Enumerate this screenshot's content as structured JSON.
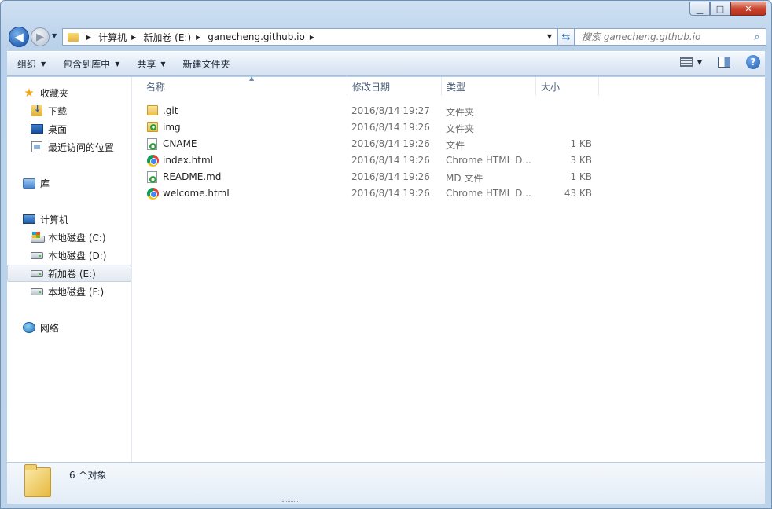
{
  "window": {
    "minimize_glyph": "▁",
    "maximize_glyph": "□",
    "close_glyph": "✕"
  },
  "nav": {
    "back_glyph": "◀",
    "forward_glyph": "▶",
    "breadcrumbs": [
      "计算机",
      "新加卷 (E:)",
      "ganecheng.github.io"
    ],
    "search_placeholder": "搜索 ganecheng.github.io"
  },
  "toolbar": {
    "organize": "组织",
    "include_in_library": "包含到库中",
    "share": "共享",
    "new_folder": "新建文件夹"
  },
  "sidebar": {
    "favorites": "收藏夹",
    "downloads": "下载",
    "desktop": "桌面",
    "recent": "最近访问的位置",
    "libraries": "库",
    "computer": "计算机",
    "drive_c": "本地磁盘 (C:)",
    "drive_d": "本地磁盘 (D:)",
    "drive_e": "新加卷 (E:)",
    "drive_f": "本地磁盘 (F:)",
    "network": "网络"
  },
  "columns": {
    "name": "名称",
    "modified": "修改日期",
    "type": "类型",
    "size": "大小"
  },
  "files": [
    {
      "name": ".git",
      "modified": "2016/8/14 19:27",
      "type": "文件夹",
      "size": "",
      "icon": "folder-icon"
    },
    {
      "name": "img",
      "modified": "2016/8/14 19:26",
      "type": "文件夹",
      "size": "",
      "icon": "folder-icon"
    },
    {
      "name": "CNAME",
      "modified": "2016/8/14 19:26",
      "type": "文件",
      "size": "1 KB",
      "icon": "document-icon"
    },
    {
      "name": "index.html",
      "modified": "2016/8/14 19:26",
      "type": "Chrome HTML D...",
      "size": "3 KB",
      "icon": "chrome-icon"
    },
    {
      "name": "README.md",
      "modified": "2016/8/14 19:26",
      "type": "MD 文件",
      "size": "1 KB",
      "icon": "document-icon"
    },
    {
      "name": "welcome.html",
      "modified": "2016/8/14 19:26",
      "type": "Chrome HTML D...",
      "size": "43 KB",
      "icon": "chrome-icon"
    }
  ],
  "details": {
    "count": "6 个对象"
  },
  "colors": {
    "frame": "#b9d1ea",
    "close_button": "#c9452f",
    "selection": "#e3e9f1"
  }
}
